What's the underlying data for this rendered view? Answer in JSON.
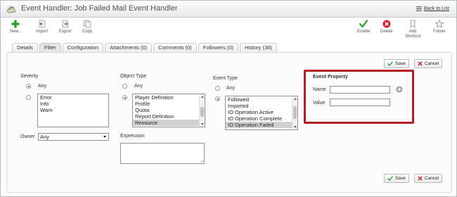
{
  "window": {
    "title": "Event Handler: Job Failed Mail Event Handler",
    "back_link": "Back to List"
  },
  "toolbar": {
    "new": "New...",
    "import": "Import",
    "export": "Export",
    "copy": "Copy",
    "enable": "Enable",
    "delete": "Delete",
    "add_shortcut_1": "Add",
    "add_shortcut_2": "Shortcut",
    "follow": "Follow"
  },
  "tabs": [
    {
      "label": "Details"
    },
    {
      "label": "Filter"
    },
    {
      "label": "Configuration"
    },
    {
      "label": "Attachments (0)"
    },
    {
      "label": "Comments (0)"
    },
    {
      "label": "Followers (0)"
    },
    {
      "label": "History (38)"
    }
  ],
  "active_tab": "Filter",
  "buttons": {
    "save": "Save",
    "cancel": "Cancel"
  },
  "severity": {
    "label": "Severity",
    "any_label": "Any",
    "options": [
      "Error",
      "Info",
      "Warn"
    ]
  },
  "owner": {
    "label": "Owner",
    "value": "Any"
  },
  "object_type": {
    "label": "Object Type",
    "any_label": "Any",
    "options": [
      "Player Definition",
      "Profile",
      "Quota",
      "Report Definition",
      "Resource"
    ],
    "selected": "Resource"
  },
  "expression": {
    "label": "Expression",
    "value": ""
  },
  "event_type": {
    "label": "Event Type",
    "any_label": "Any",
    "options": [
      "Followed",
      "Imported",
      "IO Operation Active",
      "IO Operation Complete",
      "IO Operation Failed"
    ],
    "selected": "IO Operation Failed"
  },
  "event_property": {
    "label": "Event Property",
    "name_label": "Name",
    "name_value": "",
    "value_label": "Value",
    "value_value": ""
  },
  "colors": {
    "highlight": "#b41d24",
    "enable_green": "#3aa335",
    "delete_red": "#d0232a"
  }
}
